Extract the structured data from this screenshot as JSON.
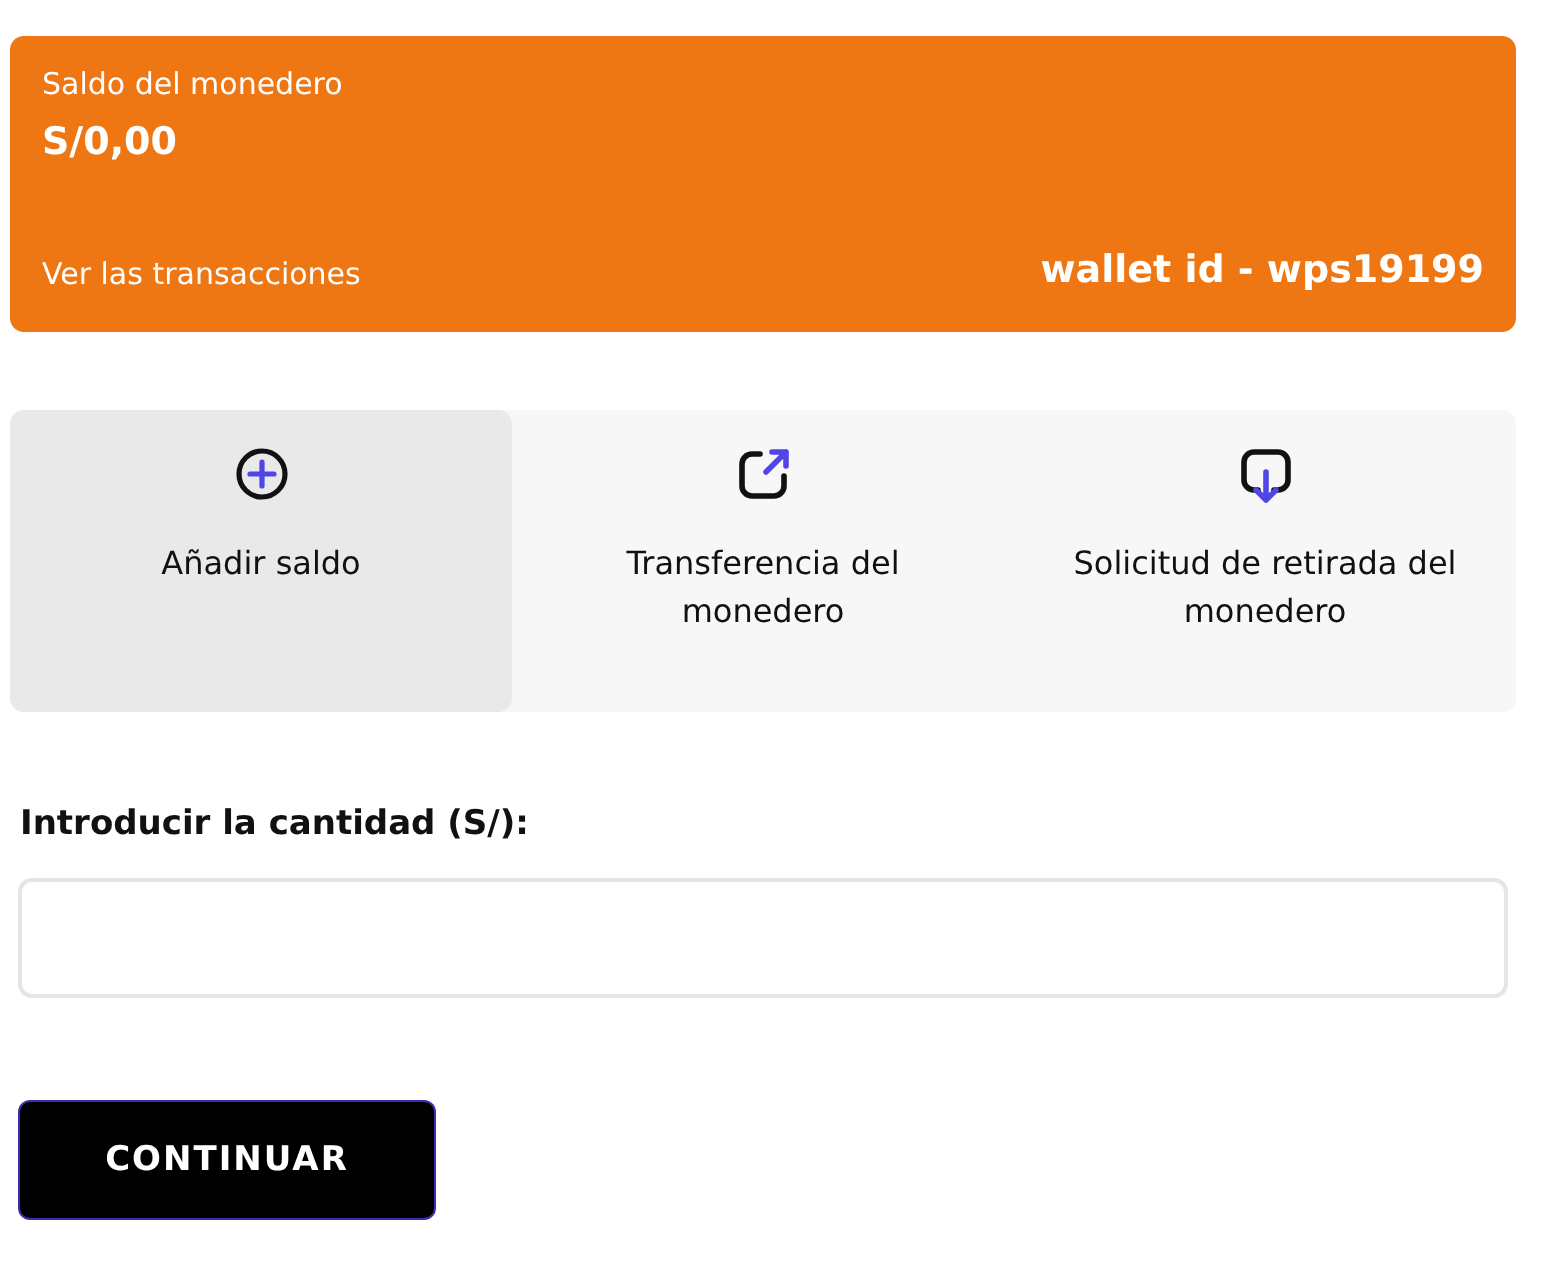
{
  "wallet": {
    "title": "Saldo del monedero",
    "balance": "S/0,00",
    "link": "Ver las transacciones",
    "wallet_id": "wallet id - wps19199"
  },
  "actions": [
    {
      "kind": "add",
      "label": "Añadir saldo",
      "selected": true
    },
    {
      "kind": "transfer",
      "label": "Transferencia del monedero",
      "selected": false
    },
    {
      "kind": "withdraw",
      "label": "Solicitud de retirada del monedero",
      "selected": false
    }
  ],
  "amount": {
    "label": "Introducir la cantidad (S/):"
  },
  "buttons": [
    "CONTINUAR"
  ]
}
